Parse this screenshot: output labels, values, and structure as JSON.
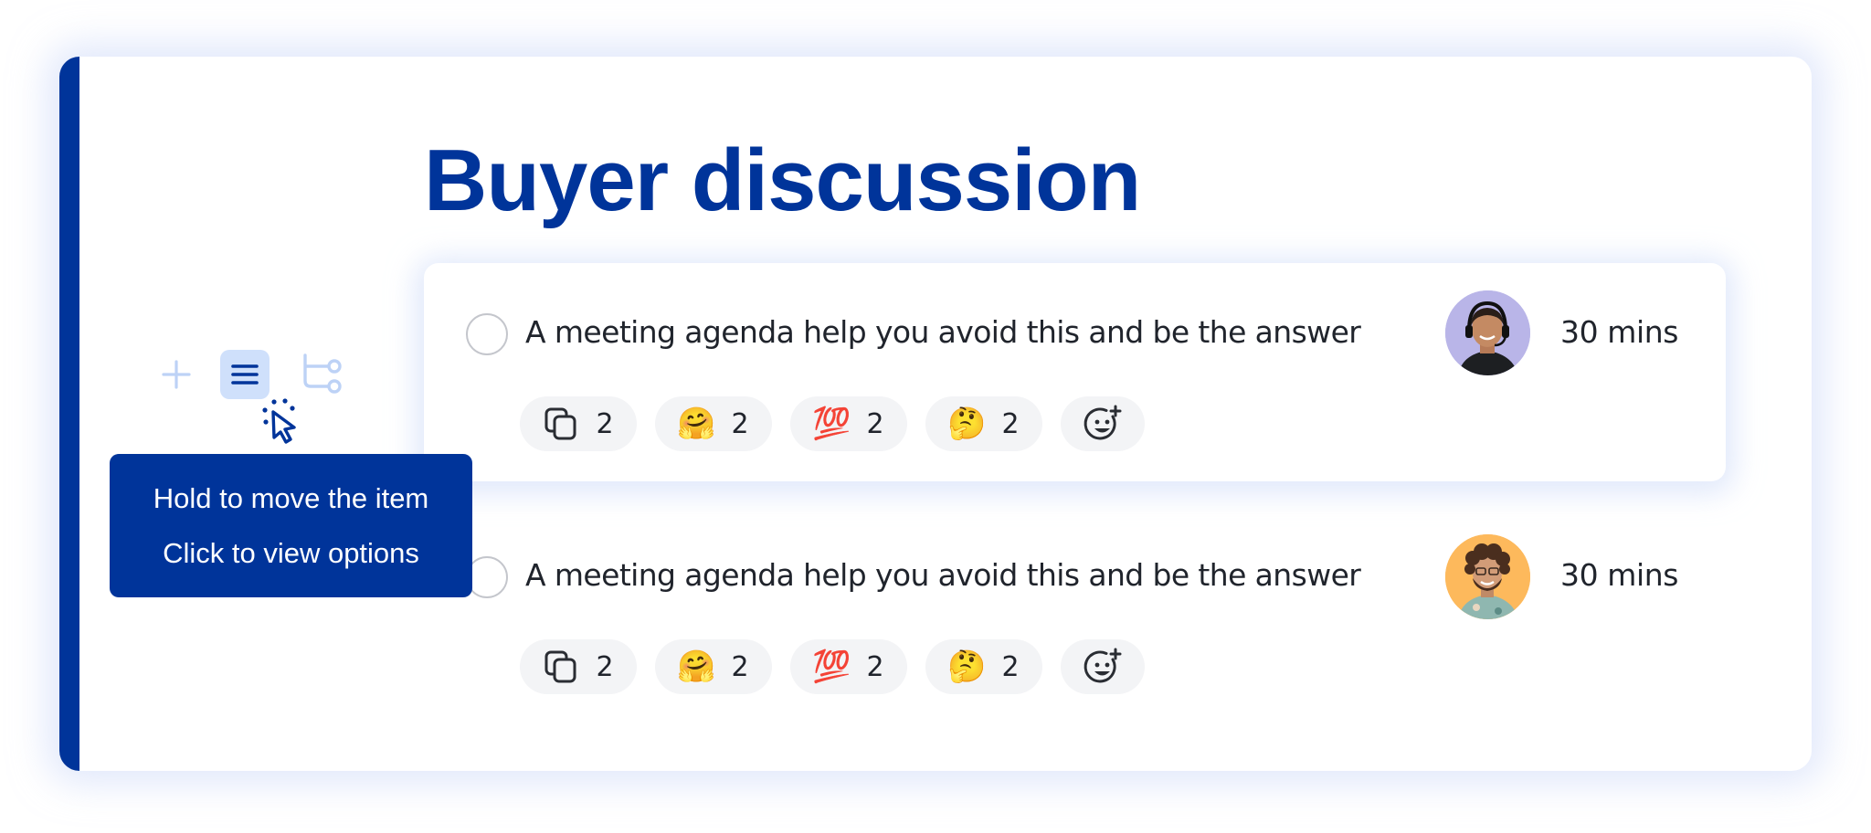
{
  "theme": {
    "accent": "#00349A",
    "accent_light": "#CFE0FB",
    "icon_light": "#BDD2F6"
  },
  "page": {
    "title": "Buyer discussion"
  },
  "toolbar": {
    "items": [
      {
        "name": "add",
        "icon": "plus-icon"
      },
      {
        "name": "drag-menu",
        "icon": "hamburger-menu-icon",
        "active": true
      },
      {
        "name": "branch",
        "icon": "branch-icon"
      }
    ]
  },
  "tooltip": {
    "line1": "Hold to move the item",
    "line2": "Click to view options"
  },
  "agenda_items": [
    {
      "text": "A meeting agenda help you avoid this and be the answer",
      "duration": "30 mins",
      "avatar": {
        "bg": "#B9B5E8",
        "description": "woman with headset"
      },
      "checked": false,
      "reactions": [
        {
          "icon": "copy-icon",
          "emoji": "",
          "count": "2"
        },
        {
          "icon": "hugging-face-emoji",
          "emoji": "🤗",
          "count": "2"
        },
        {
          "icon": "hundred-points-emoji",
          "emoji": "💯",
          "count": "2"
        },
        {
          "icon": "thinking-face-emoji",
          "emoji": "🤔",
          "count": "2"
        }
      ],
      "add_reaction_icon": "add-reaction-icon"
    },
    {
      "text": "A meeting agenda help you avoid this and be the answer",
      "duration": "30 mins",
      "avatar": {
        "bg": "#FDB95C",
        "description": "curly-haired man with beard"
      },
      "checked": false,
      "reactions": [
        {
          "icon": "copy-icon",
          "emoji": "",
          "count": "2"
        },
        {
          "icon": "hugging-face-emoji",
          "emoji": "🤗",
          "count": "2"
        },
        {
          "icon": "hundred-points-emoji",
          "emoji": "💯",
          "count": "2"
        },
        {
          "icon": "thinking-face-emoji",
          "emoji": "🤔",
          "count": "2"
        }
      ],
      "add_reaction_icon": "add-reaction-icon"
    }
  ]
}
